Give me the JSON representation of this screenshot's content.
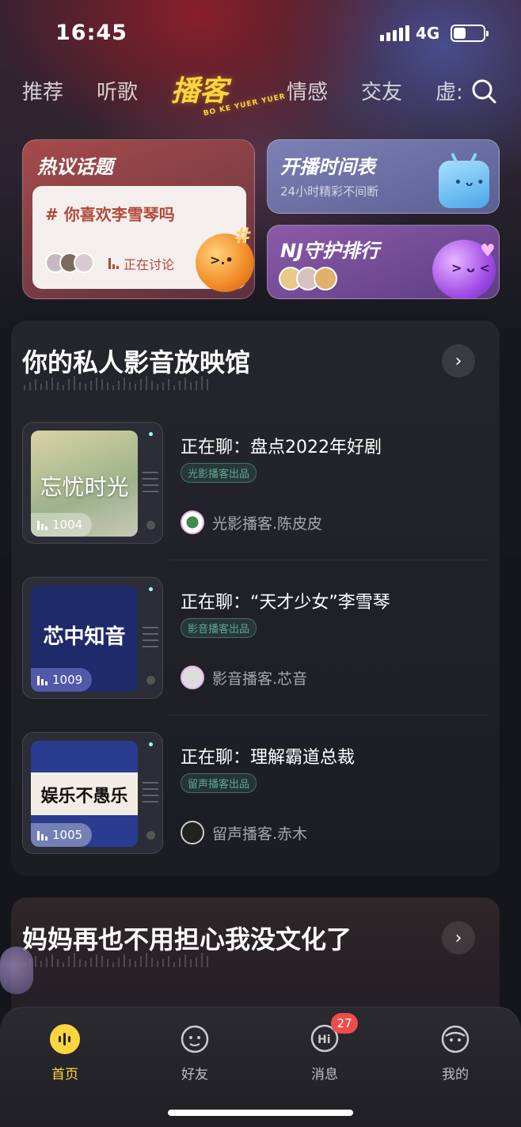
{
  "status": {
    "time": "16:45",
    "network": "4G",
    "battery_level": 0.4
  },
  "tabs": {
    "items": [
      "推荐",
      "听歌",
      "情感",
      "交友",
      "虚:"
    ],
    "active": "播客",
    "active_sub": "BO KE YUER YUER"
  },
  "hot_topic": {
    "title": "热议话题",
    "topic": "# 你喜欢李雪琴吗",
    "status": "正在讨论"
  },
  "schedule": {
    "title": "开播时间表",
    "subtitle": "24小时精彩不间断"
  },
  "ranking": {
    "title": "NJ守护排行"
  },
  "section1": {
    "title": "你的私人影音放映馆",
    "items": [
      {
        "cover_text": "忘忧时光",
        "count": "1004",
        "now": "正在聊：盘点2022年好剧",
        "tag": "光影播客出品",
        "host": "光影播客.陈皮皮",
        "cover_color": "#b7b98a"
      },
      {
        "cover_text": "芯中知音",
        "count": "1009",
        "now": "正在聊：“天才少女”李雪琴",
        "tag": "影音播客出品",
        "host": "影音播客.芯音",
        "cover_color": "#1f2a6b"
      },
      {
        "cover_text": "娱乐不愚乐",
        "count": "1005",
        "now": "正在聊：理解霸道总裁",
        "tag": "留声播客出品",
        "host": "留声播客.赤木",
        "cover_color": "#f0ece4"
      }
    ]
  },
  "section2": {
    "title": "妈妈再也不用担心我没文化了"
  },
  "nav": {
    "home": "首页",
    "friends": "好友",
    "messages": "消息",
    "messages_badge": "27",
    "me": "我的"
  },
  "colors": {
    "accent": "#ffd53d",
    "tag_green": "#5fa88f",
    "badge_red": "#ef4c4c"
  }
}
